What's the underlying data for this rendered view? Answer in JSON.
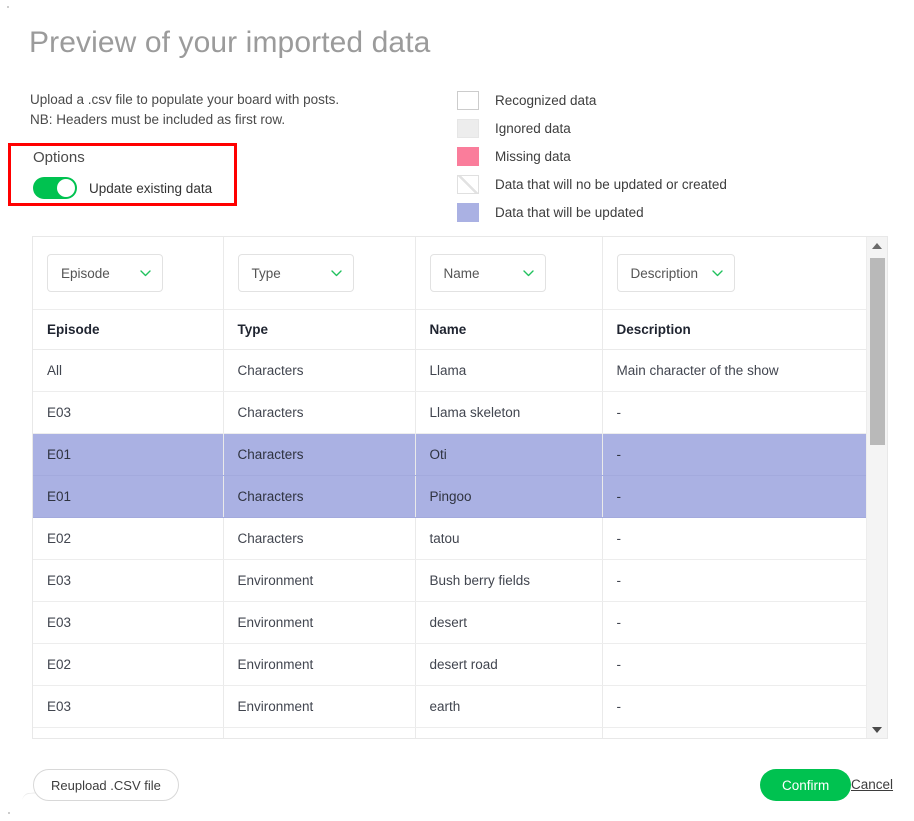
{
  "header": {
    "title": "Preview of your imported data",
    "intro_line1": "Upload a .csv file to populate your board with posts.",
    "intro_line2": "NB: Headers must be included as first row."
  },
  "options": {
    "title": "Options",
    "toggle_label": "Update existing data",
    "toggle_on": true,
    "toggle_color": "#00c250",
    "highlight_color": "#ff0000"
  },
  "legend": {
    "items": [
      {
        "label": "Recognized data",
        "swatch": "recognized",
        "color": "#ffffff"
      },
      {
        "label": "Ignored data",
        "swatch": "ignored",
        "color": "#ededed"
      },
      {
        "label": "Missing data",
        "swatch": "missing",
        "color": "#fa7d9b"
      },
      {
        "label": "Data that will no be updated or created",
        "swatch": "noupdate",
        "color": "#ffffff"
      },
      {
        "label": "Data that will be updated",
        "swatch": "willupdate",
        "color": "#aab1e3"
      }
    ]
  },
  "table": {
    "selectors": [
      {
        "value": "Episode",
        "icon": "chevron-down-icon"
      },
      {
        "value": "Type",
        "icon": "chevron-down-icon"
      },
      {
        "value": "Name",
        "icon": "chevron-down-icon"
      },
      {
        "value": "Description",
        "icon": "chevron-down-icon"
      }
    ],
    "headers": [
      "Episode",
      "Type",
      "Name",
      "Description"
    ],
    "rows": [
      {
        "cells": [
          "All",
          "Characters",
          "Llama",
          "Main character of the show"
        ],
        "state": "normal"
      },
      {
        "cells": [
          "E03",
          "Characters",
          "Llama skeleton",
          "-"
        ],
        "state": "normal"
      },
      {
        "cells": [
          "E01",
          "Characters",
          "Oti",
          "-"
        ],
        "state": "updated"
      },
      {
        "cells": [
          "E01",
          "Characters",
          "Pingoo",
          "-"
        ],
        "state": "updated"
      },
      {
        "cells": [
          "E02",
          "Characters",
          "tatou",
          "-"
        ],
        "state": "normal"
      },
      {
        "cells": [
          "E03",
          "Environment",
          "Bush berry fields",
          "-"
        ],
        "state": "normal"
      },
      {
        "cells": [
          "E03",
          "Environment",
          "desert",
          "-"
        ],
        "state": "normal"
      },
      {
        "cells": [
          "E02",
          "Environment",
          "desert road",
          "-"
        ],
        "state": "normal"
      },
      {
        "cells": [
          "E03",
          "Environment",
          "earth",
          "-"
        ],
        "state": "normal"
      },
      {
        "cells": [
          "",
          "",
          "",
          ""
        ],
        "state": "normal"
      }
    ]
  },
  "scrollbar": {
    "up_icon": "scroll-up-arrow-icon",
    "down_icon": "scroll-down-arrow-icon"
  },
  "footer": {
    "reupload_label": "Reupload .CSV file",
    "confirm_label": "Confirm",
    "cancel_label": "Cancel",
    "confirm_color": "#00c250"
  }
}
